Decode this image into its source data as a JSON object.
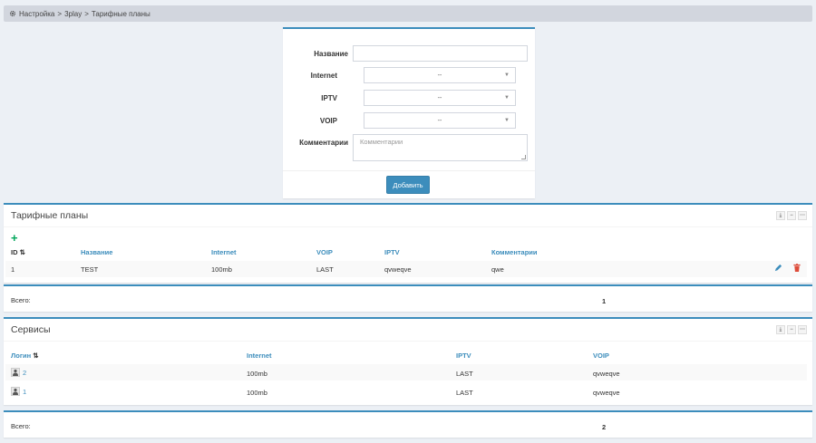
{
  "breadcrumb": {
    "items": [
      "Настройка",
      ">",
      "3play",
      ">",
      "Тарифные планы"
    ]
  },
  "form": {
    "name_label": "Название",
    "internet_label": "Internet",
    "iptv_label": "IPTV",
    "voip_label": "VOIP",
    "comment_label": "Комментарии",
    "name_value": "",
    "internet_value": "--",
    "iptv_value": "--",
    "voip_value": "--",
    "comment_placeholder": "Комментарии",
    "add_button": "Добавить"
  },
  "plans": {
    "title": "Тарифные планы",
    "add_icon": "+",
    "columns": [
      "ID",
      "Название",
      "Internet",
      "VOIP",
      "IPTV",
      "Комментарии"
    ],
    "rows": [
      {
        "id": "1",
        "name": "TEST",
        "internet": "100mb",
        "voip": "LAST",
        "iptv": "qvweqve",
        "comment": "qwe"
      }
    ],
    "total_label": "Всего:",
    "total_value": "1"
  },
  "services": {
    "title": "Сервисы",
    "columns": [
      "Логин",
      "Internet",
      "IPTV",
      "VOIP"
    ],
    "rows": [
      {
        "login": "2",
        "internet": "100mb",
        "iptv": "LAST",
        "voip": "qvweqve"
      },
      {
        "login": "1",
        "internet": "100mb",
        "iptv": "LAST",
        "voip": "qvweqve"
      }
    ],
    "total_label": "Всего:",
    "total_value": "2"
  },
  "colors": {
    "accent": "#3c8dbc",
    "add_green": "#00a65a",
    "delete_red": "#dd4b39"
  },
  "icons": [
    "gear-icon",
    "sort-icon",
    "plus-icon",
    "edit-icon",
    "delete-icon",
    "user-icon",
    "export-icon",
    "minimize-icon",
    "more-icon"
  ]
}
